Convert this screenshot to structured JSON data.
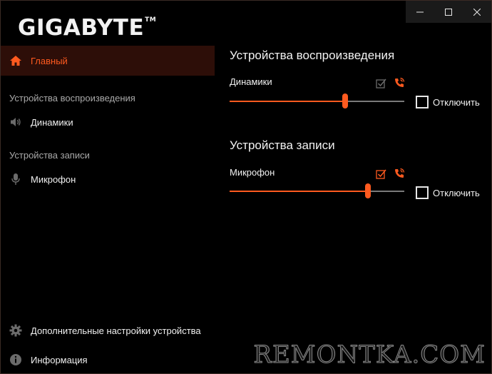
{
  "brand": {
    "logo_text": "GIGABYTE",
    "trademark": "TM"
  },
  "window_controls": {
    "minimize": "minimize-icon",
    "maximize": "maximize-icon",
    "close": "close-icon"
  },
  "sidebar": {
    "home": {
      "label": "Главный",
      "icon": "home-icon"
    },
    "playback_section": "Устройства воспроизведения",
    "speakers": {
      "label": "Динамики",
      "icon": "speaker-icon"
    },
    "recording_section": "Устройства записи",
    "microphone": {
      "label": "Микрофон",
      "icon": "microphone-icon"
    },
    "advanced": {
      "label": "Дополнительные настройки устройства",
      "icon": "gear-icon"
    },
    "info": {
      "label": "Информация",
      "icon": "info-icon"
    }
  },
  "main": {
    "playback": {
      "title": "Устройства воспроизведения",
      "device_label": "Динамики",
      "volume_percent": 66,
      "mute_label": "Отключить",
      "muted": false,
      "default_device_checked": false,
      "default_comm_checked": true
    },
    "recording": {
      "title": "Устройства записи",
      "device_label": "Микрофон",
      "volume_percent": 79,
      "mute_label": "Отключить",
      "muted": false,
      "default_device_checked": true,
      "default_comm_checked": true
    }
  },
  "colors": {
    "accent": "#ff5a1f",
    "active_bg": "#2d0e08",
    "background": "#000000",
    "muted_text": "#a9a9a9",
    "inactive_icon": "#6b6b6b"
  },
  "watermark": "REMONTKA.COM"
}
